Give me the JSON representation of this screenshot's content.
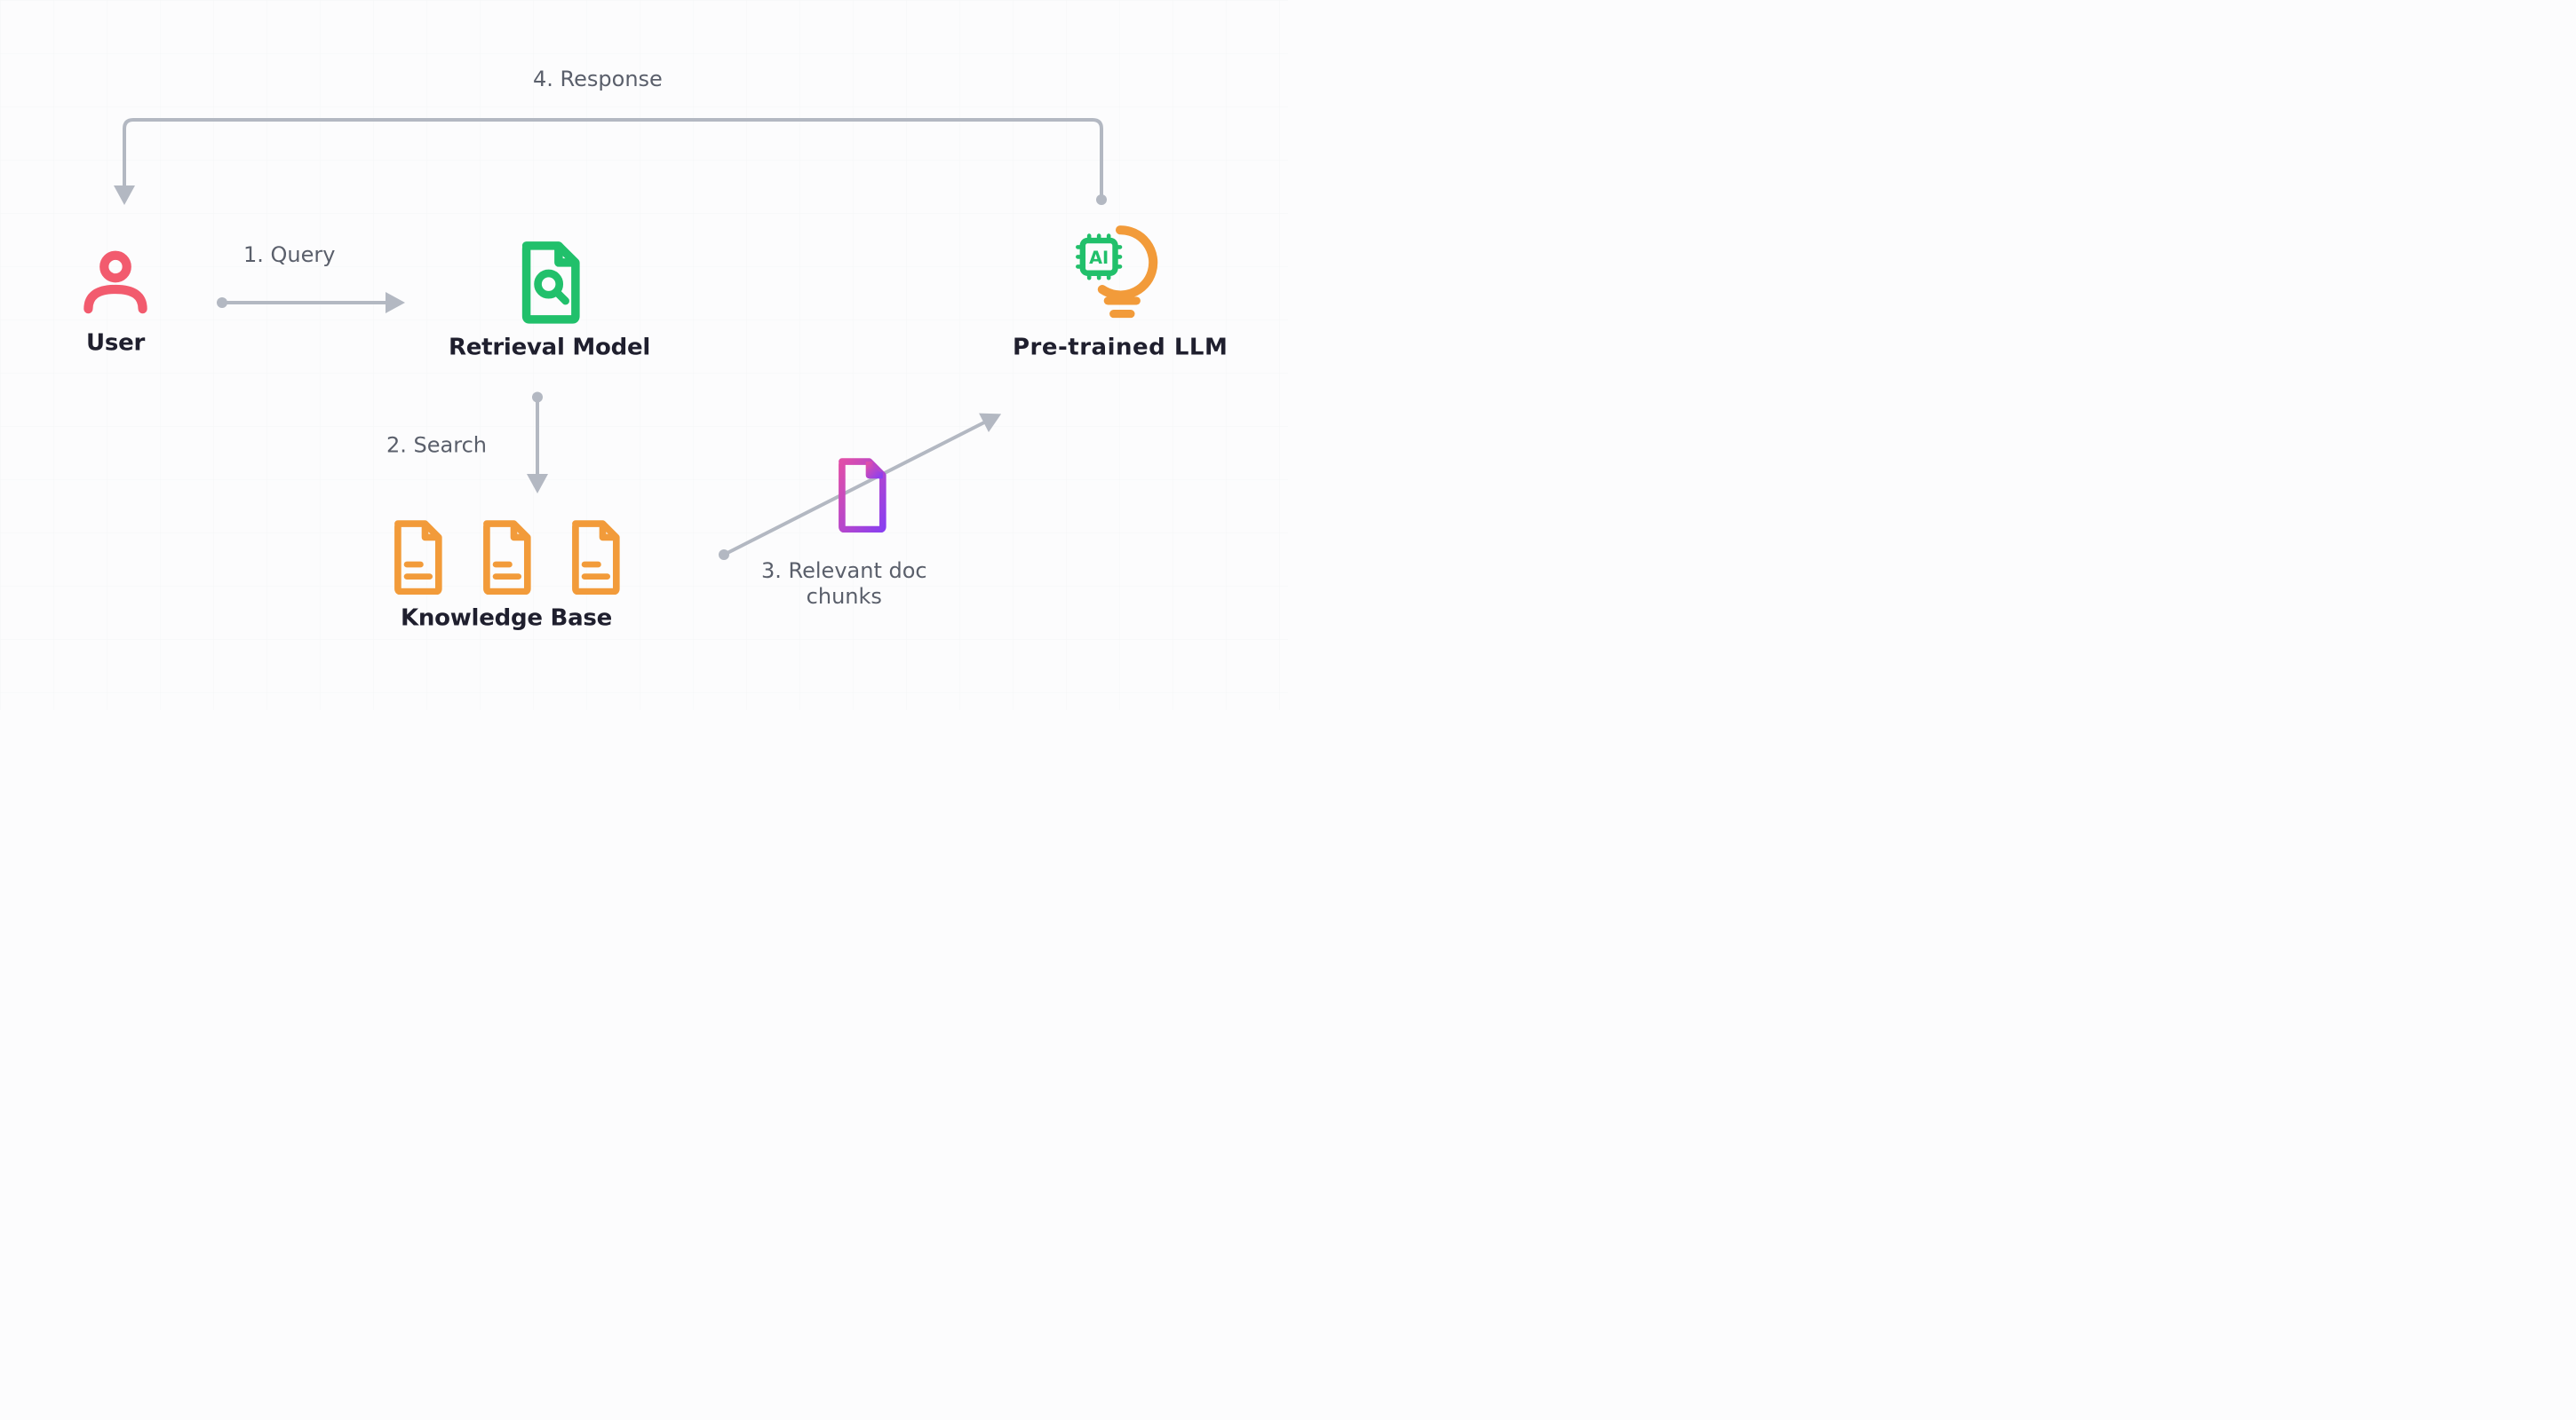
{
  "nodes": {
    "user": {
      "label": "User"
    },
    "retrieval": {
      "label": "Retrieval Model"
    },
    "knowledge_base": {
      "label": "Knowledge Base"
    },
    "llm": {
      "label": "Pre-trained LLM"
    }
  },
  "flows": {
    "query": {
      "label": "1. Query"
    },
    "search": {
      "label": "2. Search"
    },
    "chunks": {
      "label": "3. Relevant doc\nchunks"
    },
    "response": {
      "label": "4. Response"
    }
  },
  "icons": {
    "user": "user-icon",
    "retrieval": "search-document-icon",
    "doc": "document-icon",
    "chunk": "document-chunk-icon",
    "llm": "ai-lightbulb-icon"
  },
  "colors": {
    "user": "#f25b6e",
    "retrieval": "#21c06b",
    "doc": "#f29b3a",
    "chunk_a": "#e04fa9",
    "chunk_b": "#8a3ff0",
    "llm_bulb": "#f29b3a",
    "llm_chip": "#21c06b",
    "arrow": "#b3b8c2",
    "text": "#1f1f2e",
    "muted": "#5a5f6b"
  }
}
